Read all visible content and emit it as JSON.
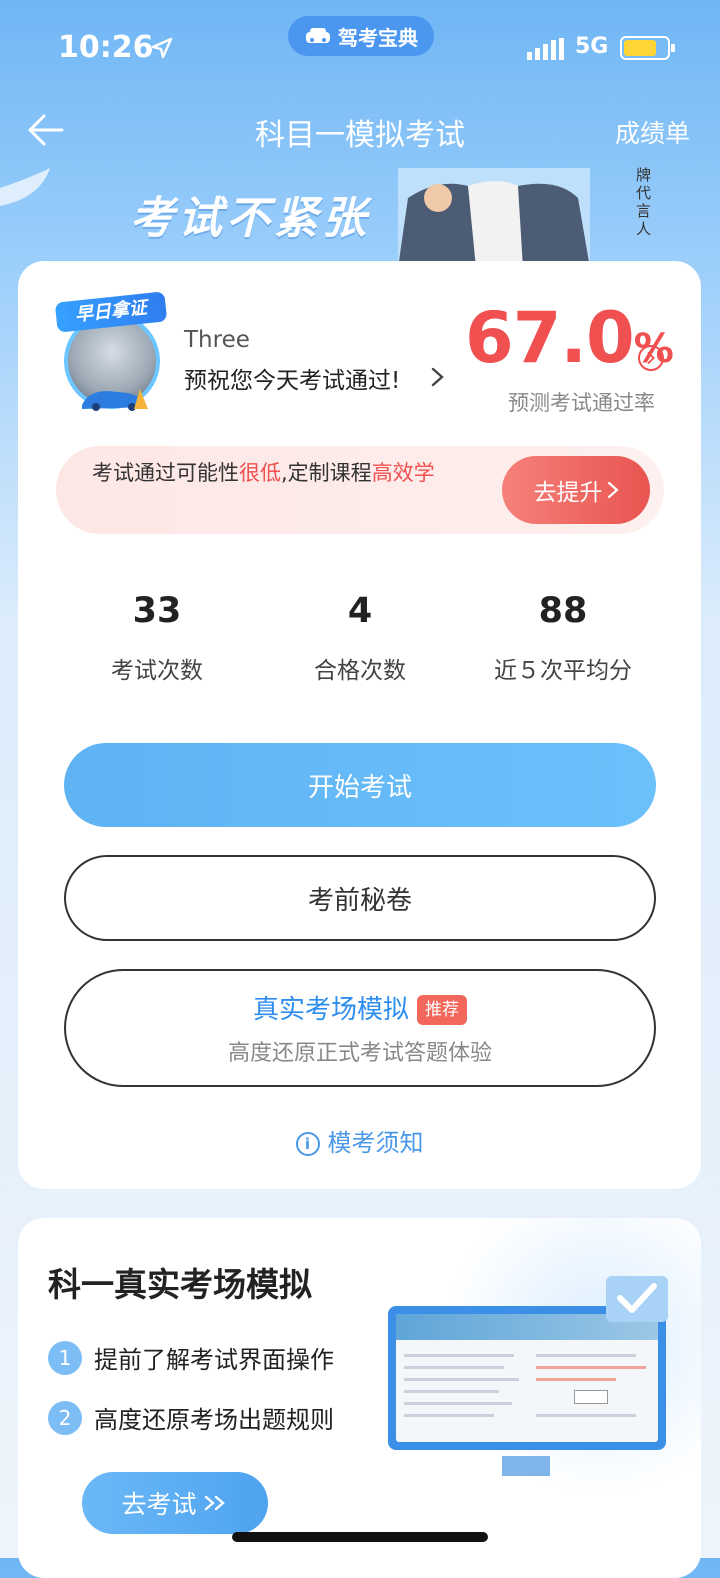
{
  "status": {
    "time": "10:26",
    "network": "5G",
    "app_pill": "驾考宝典"
  },
  "nav": {
    "title": "科目一模拟考试",
    "right": "成绩单"
  },
  "banner": {
    "slogan": "考试不紧张",
    "spokesperson": "牌代言人"
  },
  "user": {
    "badge": "早日拿证",
    "name": "Three",
    "wish": "预祝您今天考试通过!"
  },
  "pass_rate": {
    "value": "67.0",
    "unit": "%",
    "label": "预测考试通过率"
  },
  "alert": {
    "text_a": "考试通过可能性",
    "text_b": "很低",
    "text_c": ",定制课程",
    "text_d": "高效学",
    "button": "去提升"
  },
  "stats": [
    {
      "value": "33",
      "label": "考试次数"
    },
    {
      "value": "4",
      "label": "合格次数"
    },
    {
      "value": "88",
      "label": "近５次平均分"
    }
  ],
  "buttons": {
    "start": "开始考试",
    "secret": "考前秘卷",
    "real_title": "真实考场模拟",
    "real_tag": "推荐",
    "real_sub": "高度还原正式考试答题体验"
  },
  "notice": "模考须知",
  "card2": {
    "title": "科一真实考场模拟",
    "items": [
      {
        "num": "1",
        "text": "提前了解考试界面操作"
      },
      {
        "num": "2",
        "text": "高度还原考场出题规则"
      }
    ],
    "button": "去考试"
  },
  "colors": {
    "accent": "#4a98e8",
    "danger": "#f05050"
  },
  "icons": [
    "location-arrow-icon",
    "car-icon",
    "signal-icon",
    "battery-icon",
    "back-arrow-icon",
    "chevron-right-icon",
    "info-icon",
    "double-chevron-icon",
    "check-icon"
  ]
}
